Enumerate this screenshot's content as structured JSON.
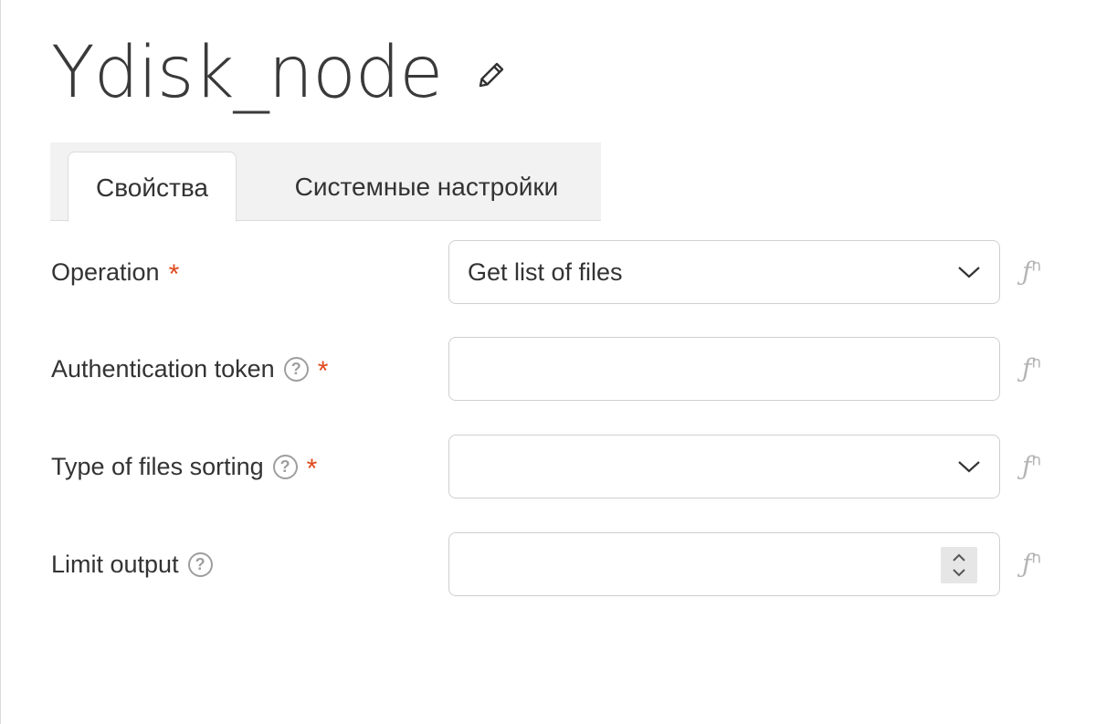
{
  "node": {
    "title": "Ydisk_node"
  },
  "tabs": [
    {
      "label": "Свойства",
      "active": true
    },
    {
      "label": "Системные настройки",
      "active": false
    }
  ],
  "form": {
    "required_mark": "*",
    "help_glyph": "?",
    "fn_label": "ƒ",
    "fn_sup": "n",
    "fields": [
      {
        "label": "Operation",
        "type": "select",
        "value": "Get list of files",
        "required": true,
        "help": false
      },
      {
        "label": "Authentication token",
        "type": "text",
        "value": "",
        "required": true,
        "help": true
      },
      {
        "label": "Type of files sorting",
        "type": "select",
        "value": "",
        "required": true,
        "help": true
      },
      {
        "label": "Limit output",
        "type": "number",
        "value": "",
        "required": false,
        "help": true
      }
    ]
  },
  "colors": {
    "required": "#e0491c",
    "tab_bar": "#f2f2f2",
    "muted_icon": "#9e9e9e"
  },
  "icons": {
    "edit": "pencil-icon",
    "select": "chevron-down-icon",
    "stepper": "spin-arrows-icon",
    "function": "function-icon",
    "help": "help-circle-icon"
  }
}
